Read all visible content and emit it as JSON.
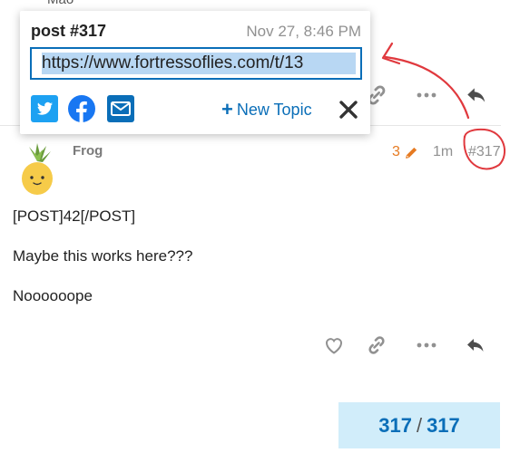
{
  "previous_post": {
    "author_fragment": "Mao"
  },
  "share_popup": {
    "title": "post #317",
    "date": "Nov 27, 8:46 PM",
    "link": "https://www.fortressoflies.com/t/13",
    "new_topic_label": "New Topic",
    "icons": [
      "twitter-icon",
      "facebook-icon",
      "email-icon",
      "plus-icon",
      "close-icon"
    ]
  },
  "post": {
    "author": "Frog",
    "edit_count": "3",
    "age": "1m",
    "post_number": "#317",
    "body": [
      "[POST]42[/POST]",
      "Maybe this works here???",
      "Noooooope"
    ],
    "actions": [
      "heart-icon",
      "link-icon",
      "more-icon",
      "reply-icon"
    ]
  },
  "topic_progress": {
    "current": "317",
    "separator": "/",
    "total": "317"
  },
  "colors": {
    "accent": "#0a6eb8",
    "edit": "#e67a21",
    "progress_bg": "#d1edfa",
    "annotation": "#e0393e"
  }
}
